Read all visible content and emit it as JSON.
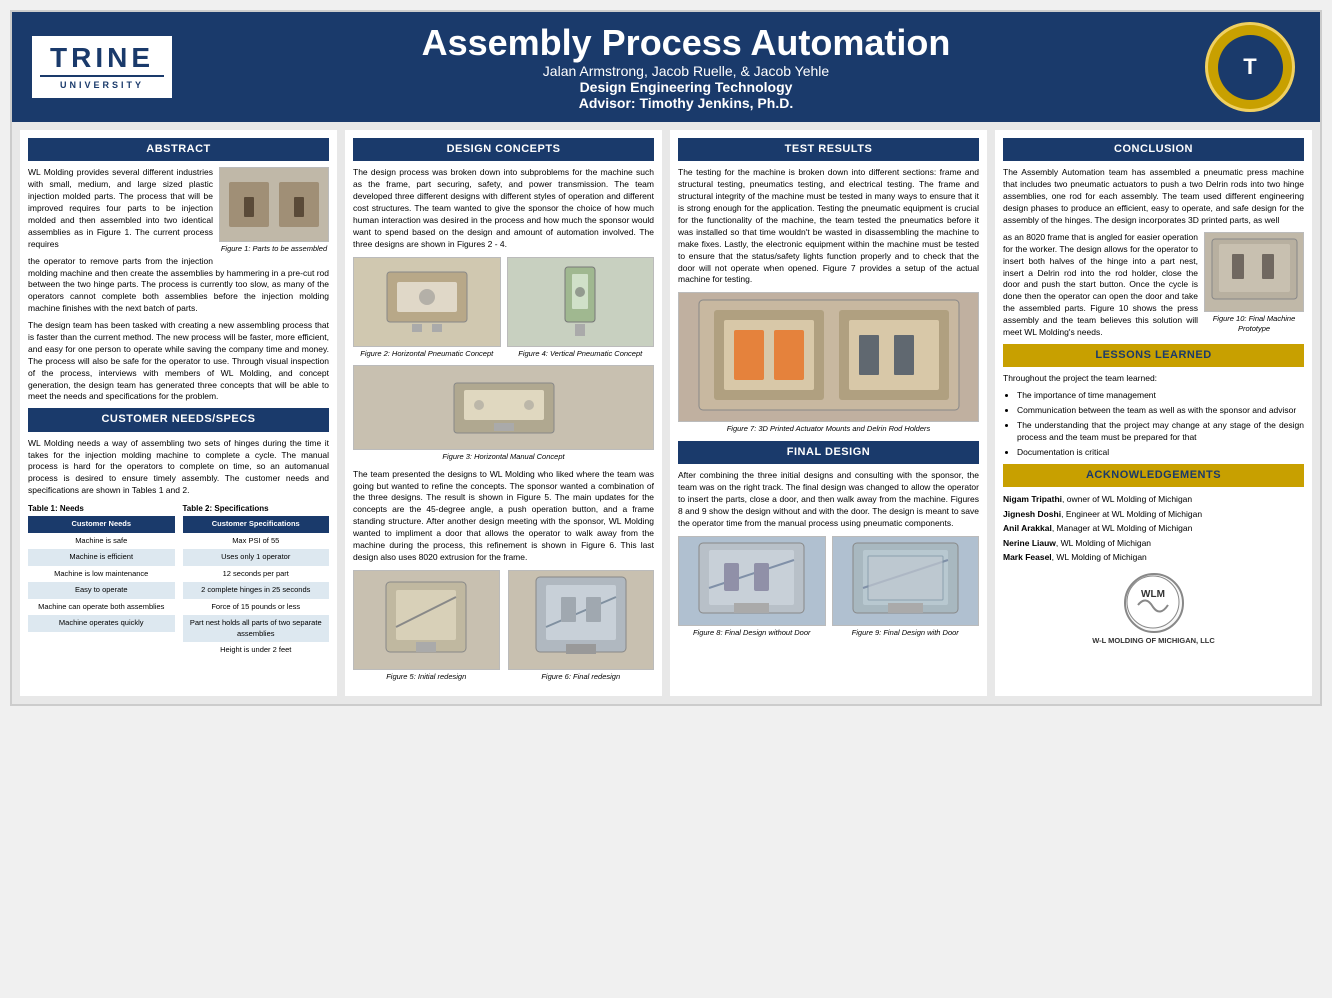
{
  "header": {
    "title": "Assembly Process Automation",
    "authors": "Jalan Armstrong, Jacob Ruelle, & Jacob Yehle",
    "dept": "Design Engineering Technology",
    "advisor": "Advisor: Timothy Jenkins, Ph.D."
  },
  "abstract": {
    "title": "ABSTRACT",
    "body1": "WL Molding provides several different industries with small, medium, and large sized plastic injection molded parts. The process that will be improved requires four parts to be injection molded and then assembled into two identical assemblies as in Figure 1. The current process requires",
    "body2": "the operator to remove parts from the injection molding machine and then create the assemblies by hammering in a pre-cut rod between the two hinge parts. The process is currently too slow, as many of the operators cannot complete both assemblies before the injection molding machine finishes with the next batch of parts.",
    "body3": "The design team has been tasked with creating a new assembling process that is faster than the current method. The new process will be faster, more efficient, and easy for one person to operate while saving the company time and money. The process will also be safe for the operator to use. Through visual inspection of the process, interviews with members of WL Molding, and concept generation, the design team has generated three concepts that will be able to meet the needs and specifications for the problem.",
    "fig1_caption": "Figure 1: Parts to be assembled"
  },
  "customer_needs": {
    "title": "CUSTOMER NEEDS/SPECS",
    "body": "WL Molding needs a way of assembling two sets of hinges during the time it takes for the injection molding machine to complete a cycle. The manual process is hard for the operators to complete on time, so an automanual process is desired to ensure timely assembly. The customer needs and specifications are shown in Tables 1 and 2.",
    "table1_label": "Table 1: Needs",
    "table1_header": "Customer Needs",
    "table1_rows": [
      "Machine is safe",
      "Machine is efficient",
      "Machine is low maintenance",
      "Easy to operate",
      "Machine can operate both assemblies",
      "Machine operates quickly"
    ],
    "table2_label": "Table 2: Specifications",
    "table2_header": "Customer Specifications",
    "table2_rows": [
      "Max PSI of 55",
      "Uses only 1 operator",
      "12 seconds per part",
      "2 complete hinges in 25 seconds",
      "Force of 15 pounds or less",
      "Part nest holds all parts of two separate assemblies",
      "Height is under 2 feet"
    ]
  },
  "design_concepts": {
    "title": "DESIGN CONCEPTS",
    "body1": "The design process was broken down into subproblems for the machine such as the frame, part securing, safety, and power transmission. The team developed three different designs with different styles of operation and different cost structures. The team wanted to give the sponsor the choice of how much human interaction was desired in the process and how much the sponsor would want to spend based on the design and amount of automation involved. The three designs are shown in Figures 2 - 4.",
    "fig2_caption": "Figure 2: Horizontal Pneumatic Concept",
    "fig3_caption": "Figure 3: Horizontal Manual Concept",
    "fig4_caption": "Figure 4: Vertical Pneumatic Concept",
    "body2": "The team presented the designs to WL Molding who liked where the team was going but wanted to refine the concepts. The sponsor wanted a combination of the three designs. The result is shown in Figure 5. The main updates for the concepts are the 45-degree angle, a push operation button, and a frame standing structure. After another design meeting with the sponsor, WL Molding wanted to impliment a door that allows the operator to walk away from the machine during the process, this refinement is shown in Figure 6. This last design also uses 8020 extrusion for the frame.",
    "fig5_caption": "Figure 5: Initial redesign",
    "fig6_caption": "Figure 6: Final redesign"
  },
  "test_results": {
    "title": "TEST RESULTS",
    "body1": "The testing for the machine is broken down into different sections: frame and structural testing, pneumatics testing, and electrical testing. The frame and structural integrity of the machine must be tested in many ways to ensure that it is strong enough for the application. Testing the pneumatic equipment is crucial for the functionality of the machine, the team tested the pneumatics before it was installed so that time wouldn't be wasted in disassembling the machine to make fixes. Lastly, the electronic equipment within the machine must be tested to ensure that the status/safety lights function properly and to check that the door will not operate when opened. Figure 7 provides a setup of the actual machine for testing.",
    "fig7_caption": "Figure 7: 3D Printed Actuator Mounts and Delrin Rod Holders"
  },
  "final_design": {
    "title": "FINAL DESIGN",
    "body": "After combining the three initial designs and consulting with the sponsor, the team was on the right track. The final design was changed to allow the operator to insert the parts, close a door, and then walk away from the machine. Figures 8 and 9 show the design without and with the door. The design is meant to save the operator time from the manual process using pneumatic components.",
    "fig8_caption": "Figure 8: Final Design without Door",
    "fig9_caption": "Figure 9: Final Design with Door"
  },
  "conclusion": {
    "title": "CONCLUSION",
    "body1": "The Assembly Automation team has assembled a pneumatic press machine that includes two pneumatic actuators to push a two Delrin rods into two hinge assemblies, one rod for each assembly. The team used different engineering design phases to produce an efficient, easy to operate, and safe design for the assembly of the hinges. The design incorporates 3D printed parts, as well",
    "body2": "as an 8020 frame that is angled for easier operation for the worker. The design allows for the operator to insert both halves of the hinge into a part nest, insert a Delrin rod into the rod holder, close the door and push the start button. Once the cycle is done then the operator can open the door and take the assembled parts. Figure 10 shows the press assembly and the team believes this solution will meet WL Molding's needs.",
    "fig10_caption": "Figure 10: Final Machine Prototype"
  },
  "lessons_learned": {
    "title": "LESSONS LEARNED",
    "intro": "Throughout the project the team learned:",
    "items": [
      "The importance of time management",
      "Communication between the team as well as with the sponsor and advisor",
      "The understanding that the project may change at any stage of the design process and the team must be prepared for that",
      "Documentation is critical"
    ]
  },
  "acknowledgements": {
    "title": "ACKNOWLEDGEMENTS",
    "body": "Nigam Tripathi, owner of WL Molding of Michigan\nJignesh Doshi, Engineer at WL Molding of Michigan\nAnil Arakkal, Manager at WL Molding of Michigan\nNerine Liauw, WL Molding of Michigan\nMark Feasel, WL Molding of Michigan",
    "logo_text": "W-L MOLDING OF MICHIGAN, LLC"
  }
}
